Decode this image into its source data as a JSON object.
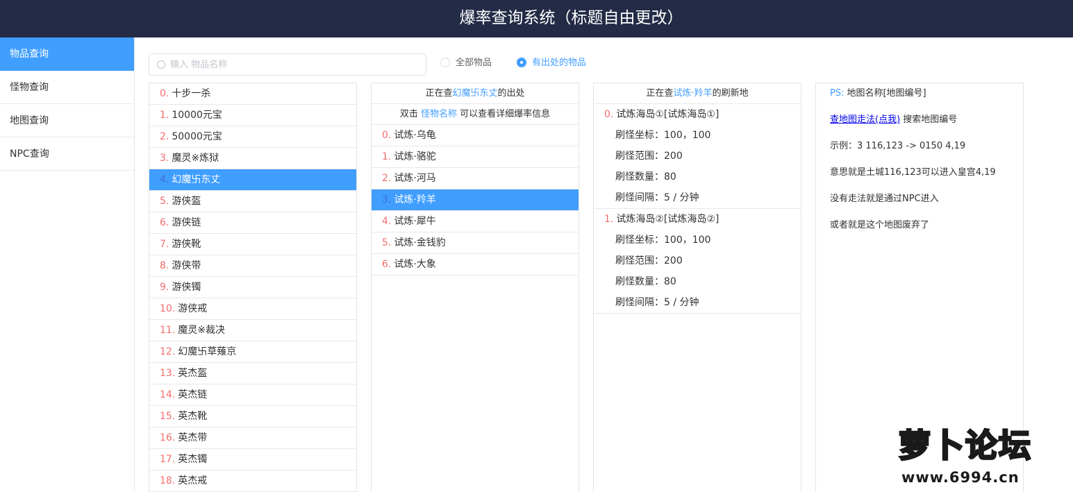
{
  "header": {
    "title": "爆率查询系统（标题自由更改）"
  },
  "sidebar": {
    "items": [
      {
        "label": "物品查询",
        "active": true
      },
      {
        "label": "怪物查询",
        "active": false
      },
      {
        "label": "地图查询",
        "active": false
      },
      {
        "label": "NPC查询",
        "active": false
      }
    ]
  },
  "search": {
    "placeholder": "输入 物品名称",
    "value": ""
  },
  "filter": {
    "options": [
      {
        "label": "全部物品",
        "checked": false
      },
      {
        "label": "有出处的物品",
        "checked": true
      }
    ]
  },
  "items_list": {
    "selected_index": 4,
    "rows": [
      {
        "idx": "0.",
        "name": "十步一杀"
      },
      {
        "idx": "1.",
        "name": "10000元宝"
      },
      {
        "idx": "2.",
        "name": "50000元宝"
      },
      {
        "idx": "3.",
        "name": "魔灵※炼狱"
      },
      {
        "idx": "4.",
        "name": "幻魔卐东丈"
      },
      {
        "idx": "5.",
        "name": "游侠盔"
      },
      {
        "idx": "6.",
        "name": "游侠链"
      },
      {
        "idx": "7.",
        "name": "游侠靴"
      },
      {
        "idx": "8.",
        "name": "游侠带"
      },
      {
        "idx": "9.",
        "name": "游侠镯"
      },
      {
        "idx": "10.",
        "name": "游侠戒"
      },
      {
        "idx": "11.",
        "name": "魔灵※裁决"
      },
      {
        "idx": "12.",
        "name": "幻魔卐草薙京"
      },
      {
        "idx": "13.",
        "name": "英杰盔"
      },
      {
        "idx": "14.",
        "name": "英杰链"
      },
      {
        "idx": "15.",
        "name": "英杰靴"
      },
      {
        "idx": "16.",
        "name": "英杰带"
      },
      {
        "idx": "17.",
        "name": "英杰镯"
      },
      {
        "idx": "18.",
        "name": "英杰戒"
      }
    ]
  },
  "monster_panel": {
    "head_prefix": "正在查",
    "head_item": "幻魔卐东丈",
    "head_suffix": "的出处",
    "hint_prefix": "双击 ",
    "hint_link": "怪物名称",
    "hint_suffix": " 可以查看详细爆率信息",
    "selected_index": 3,
    "rows": [
      {
        "idx": "0.",
        "name": "试炼·乌龟"
      },
      {
        "idx": "1.",
        "name": "试炼·骆驼"
      },
      {
        "idx": "2.",
        "name": "试炼·河马"
      },
      {
        "idx": "3.",
        "name": "试炼·羚羊"
      },
      {
        "idx": "4.",
        "name": "试炼·犀牛"
      },
      {
        "idx": "5.",
        "name": "试炼·金钱豹"
      },
      {
        "idx": "6.",
        "name": "试炼·大象"
      }
    ]
  },
  "spawn_panel": {
    "head_prefix": "正在查",
    "head_monster": "试炼·羚羊",
    "head_suffix": "的刷新地",
    "groups": [
      {
        "idx": "0.",
        "title": "试炼海岛①[试炼海岛①]",
        "lines": [
          "刷怪坐标：100，100",
          "刷怪范围：200",
          "刷怪数量：80",
          "刷怪间隔：5 / 分钟"
        ]
      },
      {
        "idx": "1.",
        "title": "试炼海岛②[试炼海岛②]",
        "lines": [
          "刷怪坐标：100，100",
          "刷怪范围：200",
          "刷怪数量：80",
          "刷怪间隔：5 / 分钟"
        ]
      }
    ]
  },
  "info_panel": {
    "ps_label": "PS:",
    "ps_text": "地图名称[地图编号]",
    "link_text": "查地图走法(点我)",
    "link_suffix": " 搜索地图编号",
    "example": "示例：3 116,123 -> 0150 4,19",
    "meaning": "意思就是土城116,123可以进入皇宫4,19",
    "no_path": "没有走法就是通过NPC进入",
    "abandoned": "或者就是这个地图废弃了"
  },
  "watermark": {
    "logo_text": "萝卜论坛",
    "url": "www.6994.cn"
  },
  "colors": {
    "header_bg": "#232b46",
    "accent": "#409eff",
    "index_red": "#f56c6c"
  }
}
